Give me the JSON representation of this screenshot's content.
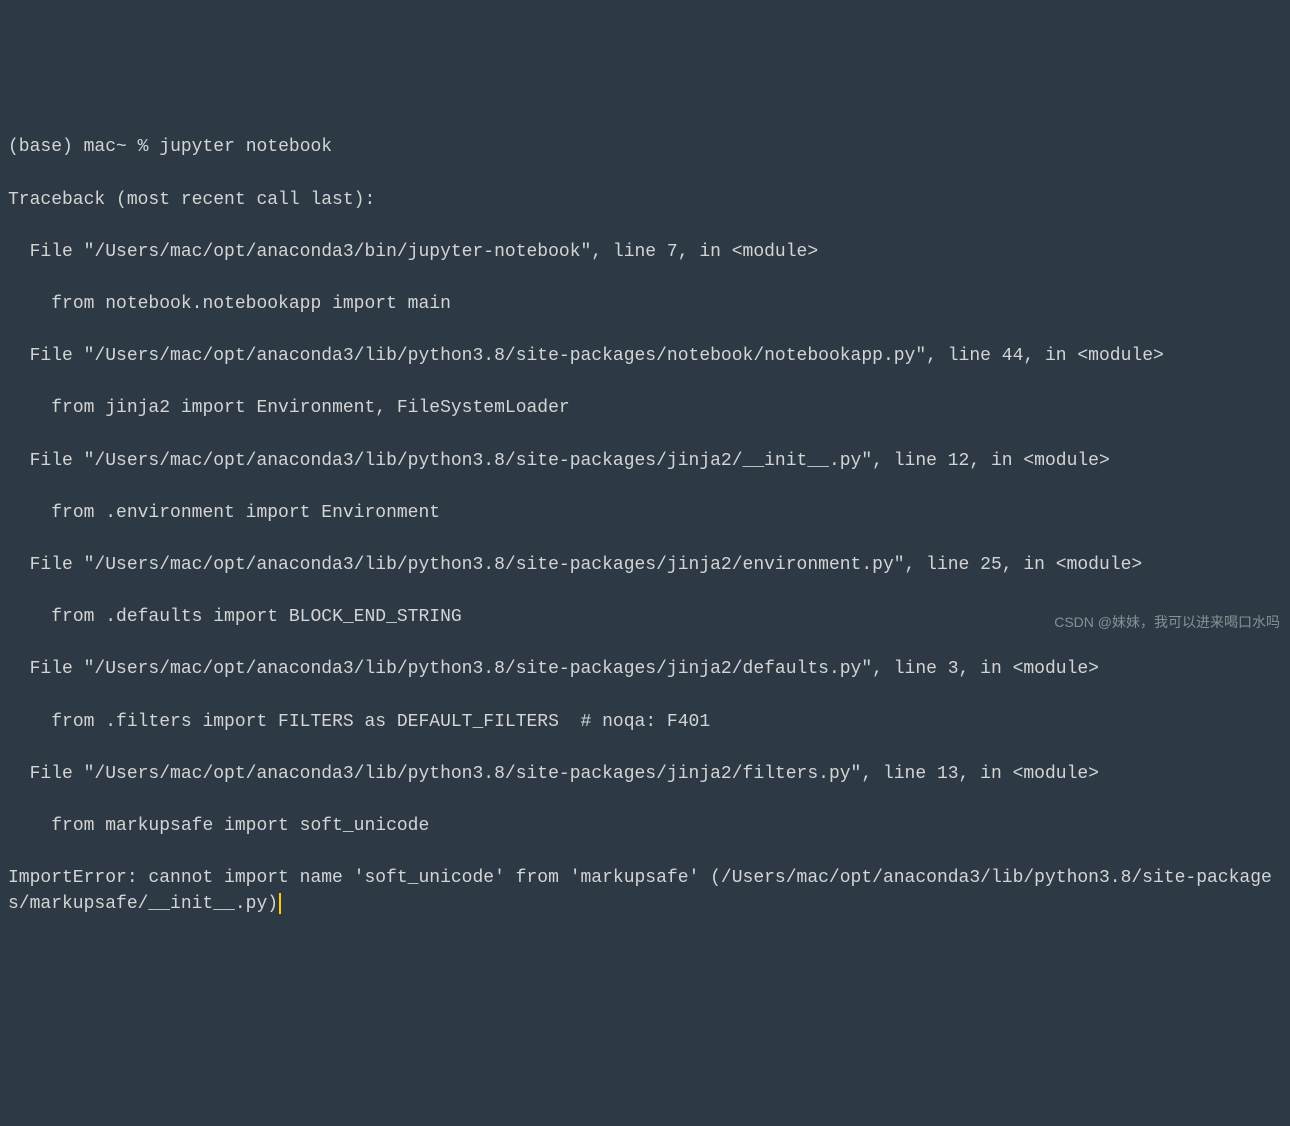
{
  "prompt": {
    "env": "(base)",
    "host": "mac~",
    "symbol": "%",
    "command": "jupyter notebook"
  },
  "traceback": {
    "header": "Traceback (most recent call last):",
    "frames": [
      {
        "loc": "  File \"/Users/mac/opt/anaconda3/bin/jupyter-notebook\", line 7, in <module>",
        "code": "    from notebook.notebookapp import main"
      },
      {
        "loc": "  File \"/Users/mac/opt/anaconda3/lib/python3.8/site-packages/notebook/notebookapp.py\", line 44, in <module>",
        "code": "    from jinja2 import Environment, FileSystemLoader"
      },
      {
        "loc": "  File \"/Users/mac/opt/anaconda3/lib/python3.8/site-packages/jinja2/__init__.py\", line 12, in <module>",
        "code": "    from .environment import Environment"
      },
      {
        "loc": "  File \"/Users/mac/opt/anaconda3/lib/python3.8/site-packages/jinja2/environment.py\", line 25, in <module>",
        "code": "    from .defaults import BLOCK_END_STRING"
      },
      {
        "loc": "  File \"/Users/mac/opt/anaconda3/lib/python3.8/site-packages/jinja2/defaults.py\", line 3, in <module>",
        "code": "    from .filters import FILTERS as DEFAULT_FILTERS  # noqa: F401"
      },
      {
        "loc": "  File \"/Users/mac/opt/anaconda3/lib/python3.8/site-packages/jinja2/filters.py\", line 13, in <module>",
        "code": "    from markupsafe import soft_unicode"
      }
    ],
    "error": "ImportError: cannot import name 'soft_unicode' from 'markupsafe' (/Users/mac/opt/anaconda3/lib/python3.8/site-packages/markupsafe/__init__.py)"
  },
  "watermark": "CSDN @妹妹，我可以进来喝口水吗"
}
